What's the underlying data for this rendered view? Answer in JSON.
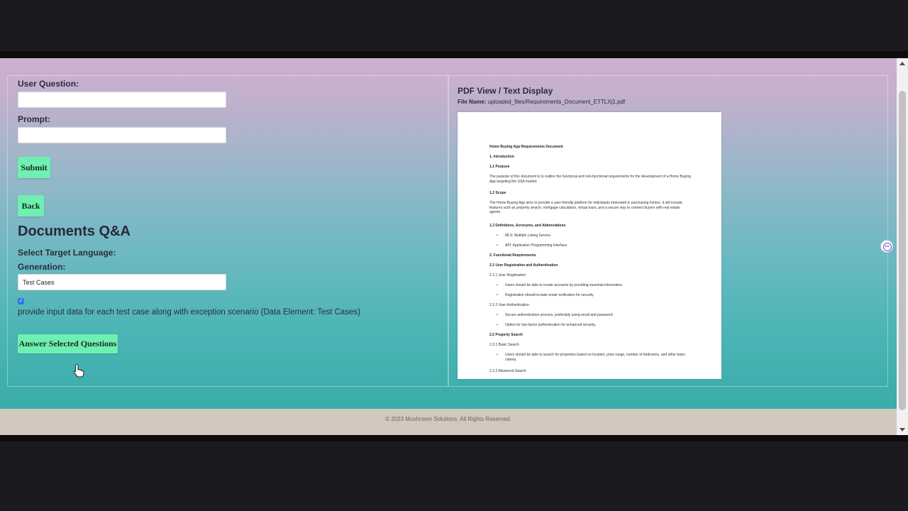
{
  "form": {
    "user_question_label": "User Question:",
    "user_question_value": "",
    "prompt_label": "Prompt:",
    "prompt_value": "",
    "submit_label": "Submit",
    "back_label": "Back"
  },
  "qa": {
    "heading": "Documents Q&A",
    "target_language_label": "Select Target Language:",
    "generation_label": "Generation:",
    "generation_value": "Test Cases",
    "checkbox_checked": true,
    "checkbox_label": "provide input data for each test case along with exception scenario (Data Element: Test Cases)",
    "answer_button_label": "Answer Selected Questions"
  },
  "pdf": {
    "title": "PDF View / Text Display",
    "file_name_label": "File Name:",
    "file_name": "uploaded_files/Requirements_Document_ETTLXj1.pdf",
    "doc_lines": [
      "Home Buying App Requirements Document",
      "1. Introduction",
      "1.1 Purpose",
      "The purpose of this document is to outline the functional and non-functional requirements for the development of a Home Buying App targeting the USA market.",
      "1.2 Scope",
      "The Home Buying App aims to provide a user-friendly platform for individuals interested in purchasing homes. It will include features such as property search, mortgage calculators, virtual tours, and a secure way to connect buyers with real estate agents.",
      "1.3 Definitions, Acronyms, and Abbreviations",
      "MLS: Multiple Listing Service",
      "API: Application Programming Interface",
      "2. Functional Requirements",
      "2.1 User Registration and Authentication",
      "2.1.1 User Registration",
      "Users should be able to create accounts by providing essential information.",
      "Registration should include email verification for security.",
      "2.1.2 User Authentication",
      "Secure authentication process, preferably using email and password.",
      "Option for two-factor authentication for enhanced security.",
      "2.2 Property Search",
      "2.2.1 Basic Search",
      "Users should be able to search for properties based on location, price range, number of bedrooms, and other basic criteria.",
      "2.2.2 Advanced Search"
    ]
  },
  "footer": {
    "text": "© 2023 Mushroom Solutions. All Rights Reserved."
  },
  "icons": {
    "assistant": "assistant-face-icon",
    "cursor": "hand-pointer-icon"
  },
  "colors": {
    "button": "#6ef0b0",
    "checkbox": "#2a7de1",
    "gradient_top": "#cfb0cf",
    "gradient_bottom": "#33aaa6",
    "footer_bg": "#d2c8be"
  }
}
